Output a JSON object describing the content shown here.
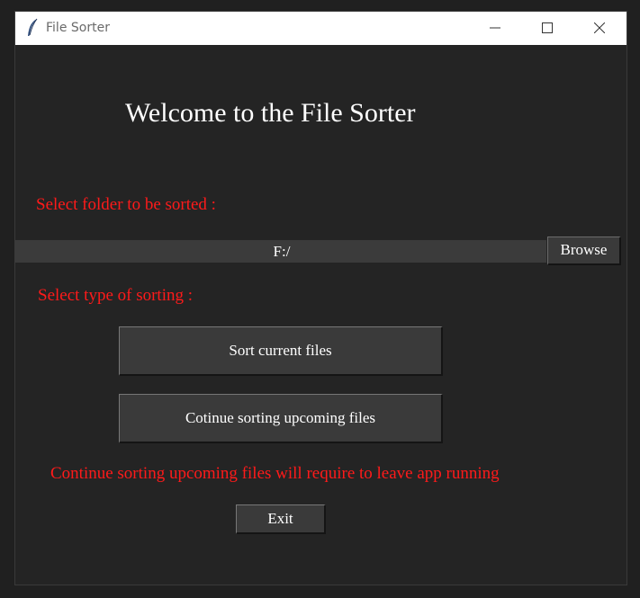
{
  "window": {
    "title": "File Sorter",
    "icon": "feather-icon",
    "controls": {
      "minimize": "minimize-icon",
      "maximize": "maximize-icon",
      "close": "close-icon"
    }
  },
  "main": {
    "heading": "Welcome to the File Sorter",
    "folder_label": "Select folder to be sorted :",
    "folder_path": "F:/",
    "browse_label": "Browse",
    "sort_type_label": "Select type of sorting :",
    "sort_current_label": "Sort current files",
    "sort_upcoming_label": "Cotinue sorting upcoming files",
    "note": "Continue sorting upcoming files will require to leave app running",
    "exit_label": "Exit"
  },
  "colors": {
    "background": "#242424",
    "accent_text": "#ff1a1a",
    "button": "#3a3a3a",
    "field": "#3b3b3b"
  }
}
